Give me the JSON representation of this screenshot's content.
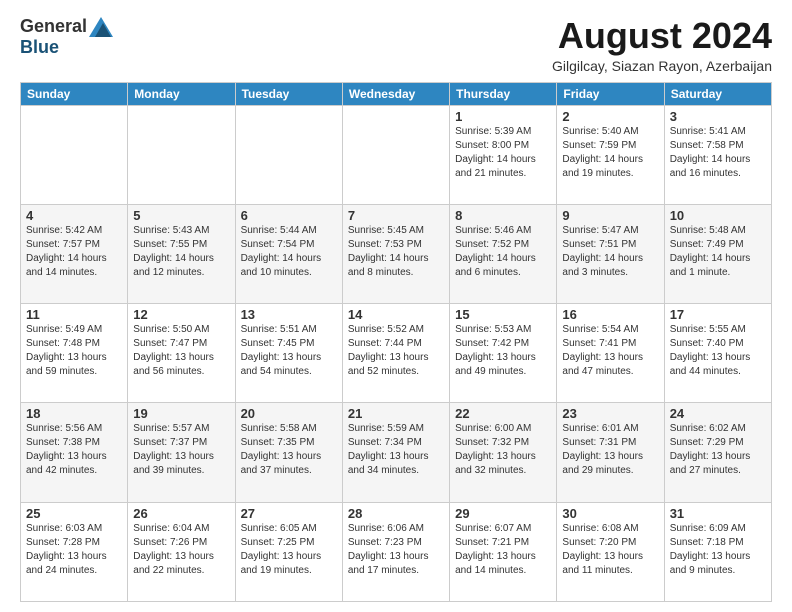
{
  "header": {
    "logo_general": "General",
    "logo_blue": "Blue",
    "month_title": "August 2024",
    "location": "Gilgilcay, Siazan Rayon, Azerbaijan"
  },
  "weekdays": [
    "Sunday",
    "Monday",
    "Tuesday",
    "Wednesday",
    "Thursday",
    "Friday",
    "Saturday"
  ],
  "weeks": [
    [
      {
        "day": "",
        "info": ""
      },
      {
        "day": "",
        "info": ""
      },
      {
        "day": "",
        "info": ""
      },
      {
        "day": "",
        "info": ""
      },
      {
        "day": "1",
        "info": "Sunrise: 5:39 AM\nSunset: 8:00 PM\nDaylight: 14 hours\nand 21 minutes."
      },
      {
        "day": "2",
        "info": "Sunrise: 5:40 AM\nSunset: 7:59 PM\nDaylight: 14 hours\nand 19 minutes."
      },
      {
        "day": "3",
        "info": "Sunrise: 5:41 AM\nSunset: 7:58 PM\nDaylight: 14 hours\nand 16 minutes."
      }
    ],
    [
      {
        "day": "4",
        "info": "Sunrise: 5:42 AM\nSunset: 7:57 PM\nDaylight: 14 hours\nand 14 minutes."
      },
      {
        "day": "5",
        "info": "Sunrise: 5:43 AM\nSunset: 7:55 PM\nDaylight: 14 hours\nand 12 minutes."
      },
      {
        "day": "6",
        "info": "Sunrise: 5:44 AM\nSunset: 7:54 PM\nDaylight: 14 hours\nand 10 minutes."
      },
      {
        "day": "7",
        "info": "Sunrise: 5:45 AM\nSunset: 7:53 PM\nDaylight: 14 hours\nand 8 minutes."
      },
      {
        "day": "8",
        "info": "Sunrise: 5:46 AM\nSunset: 7:52 PM\nDaylight: 14 hours\nand 6 minutes."
      },
      {
        "day": "9",
        "info": "Sunrise: 5:47 AM\nSunset: 7:51 PM\nDaylight: 14 hours\nand 3 minutes."
      },
      {
        "day": "10",
        "info": "Sunrise: 5:48 AM\nSunset: 7:49 PM\nDaylight: 14 hours\nand 1 minute."
      }
    ],
    [
      {
        "day": "11",
        "info": "Sunrise: 5:49 AM\nSunset: 7:48 PM\nDaylight: 13 hours\nand 59 minutes."
      },
      {
        "day": "12",
        "info": "Sunrise: 5:50 AM\nSunset: 7:47 PM\nDaylight: 13 hours\nand 56 minutes."
      },
      {
        "day": "13",
        "info": "Sunrise: 5:51 AM\nSunset: 7:45 PM\nDaylight: 13 hours\nand 54 minutes."
      },
      {
        "day": "14",
        "info": "Sunrise: 5:52 AM\nSunset: 7:44 PM\nDaylight: 13 hours\nand 52 minutes."
      },
      {
        "day": "15",
        "info": "Sunrise: 5:53 AM\nSunset: 7:42 PM\nDaylight: 13 hours\nand 49 minutes."
      },
      {
        "day": "16",
        "info": "Sunrise: 5:54 AM\nSunset: 7:41 PM\nDaylight: 13 hours\nand 47 minutes."
      },
      {
        "day": "17",
        "info": "Sunrise: 5:55 AM\nSunset: 7:40 PM\nDaylight: 13 hours\nand 44 minutes."
      }
    ],
    [
      {
        "day": "18",
        "info": "Sunrise: 5:56 AM\nSunset: 7:38 PM\nDaylight: 13 hours\nand 42 minutes."
      },
      {
        "day": "19",
        "info": "Sunrise: 5:57 AM\nSunset: 7:37 PM\nDaylight: 13 hours\nand 39 minutes."
      },
      {
        "day": "20",
        "info": "Sunrise: 5:58 AM\nSunset: 7:35 PM\nDaylight: 13 hours\nand 37 minutes."
      },
      {
        "day": "21",
        "info": "Sunrise: 5:59 AM\nSunset: 7:34 PM\nDaylight: 13 hours\nand 34 minutes."
      },
      {
        "day": "22",
        "info": "Sunrise: 6:00 AM\nSunset: 7:32 PM\nDaylight: 13 hours\nand 32 minutes."
      },
      {
        "day": "23",
        "info": "Sunrise: 6:01 AM\nSunset: 7:31 PM\nDaylight: 13 hours\nand 29 minutes."
      },
      {
        "day": "24",
        "info": "Sunrise: 6:02 AM\nSunset: 7:29 PM\nDaylight: 13 hours\nand 27 minutes."
      }
    ],
    [
      {
        "day": "25",
        "info": "Sunrise: 6:03 AM\nSunset: 7:28 PM\nDaylight: 13 hours\nand 24 minutes."
      },
      {
        "day": "26",
        "info": "Sunrise: 6:04 AM\nSunset: 7:26 PM\nDaylight: 13 hours\nand 22 minutes."
      },
      {
        "day": "27",
        "info": "Sunrise: 6:05 AM\nSunset: 7:25 PM\nDaylight: 13 hours\nand 19 minutes."
      },
      {
        "day": "28",
        "info": "Sunrise: 6:06 AM\nSunset: 7:23 PM\nDaylight: 13 hours\nand 17 minutes."
      },
      {
        "day": "29",
        "info": "Sunrise: 6:07 AM\nSunset: 7:21 PM\nDaylight: 13 hours\nand 14 minutes."
      },
      {
        "day": "30",
        "info": "Sunrise: 6:08 AM\nSunset: 7:20 PM\nDaylight: 13 hours\nand 11 minutes."
      },
      {
        "day": "31",
        "info": "Sunrise: 6:09 AM\nSunset: 7:18 PM\nDaylight: 13 hours\nand 9 minutes."
      }
    ]
  ]
}
